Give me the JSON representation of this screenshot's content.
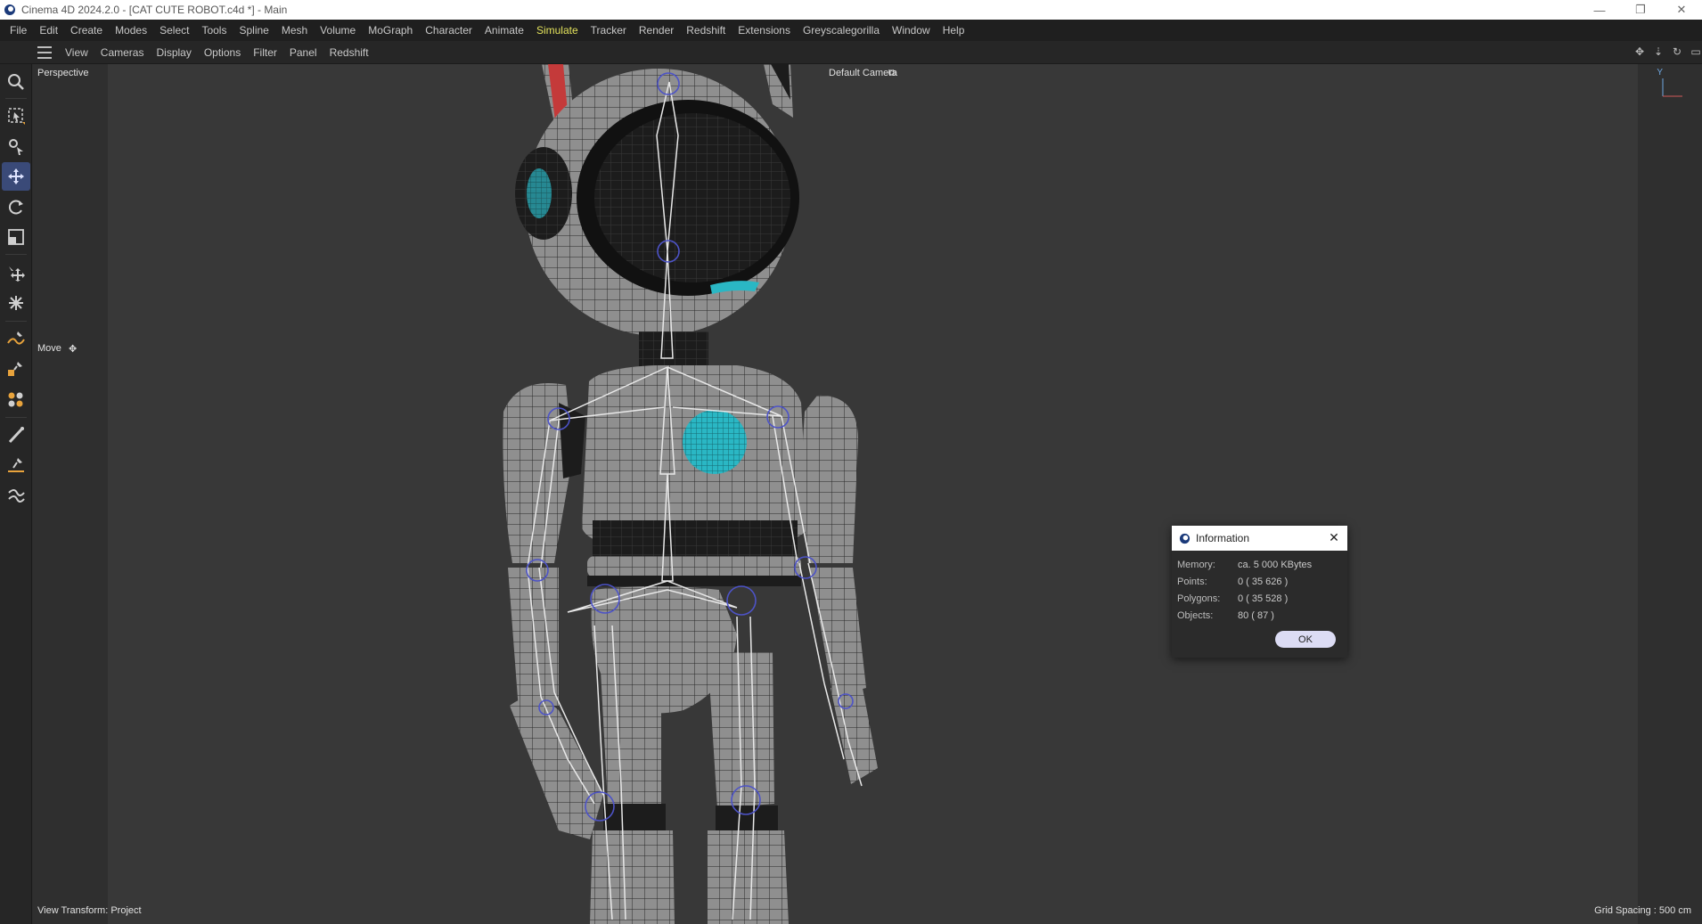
{
  "window": {
    "title": "Cinema 4D 2024.2.0 - [CAT CUTE ROBOT.c4d *] - Main",
    "controls": [
      "—",
      "❐",
      "✕"
    ]
  },
  "menubar": {
    "items": [
      "File",
      "Edit",
      "Create",
      "Modes",
      "Select",
      "Tools",
      "Spline",
      "Mesh",
      "Volume",
      "MoGraph",
      "Character",
      "Animate",
      "Simulate",
      "Tracker",
      "Render",
      "Redshift",
      "Extensions",
      "Greyscalegorilla",
      "Window",
      "Help"
    ],
    "active": "Simulate",
    "active_color": "#e3e25c"
  },
  "viewport_menu": {
    "items": [
      "View",
      "Cameras",
      "Display",
      "Options",
      "Filter",
      "Panel",
      "Redshift"
    ]
  },
  "toolbar": {
    "tools": [
      "search-icon",
      "live-selection-icon",
      "selection-tools-icon",
      "move-icon",
      "rotate-icon",
      "scale-icon",
      "move-along-icon",
      "transform-icon",
      "spline-pen-icon",
      "object-pen-icon",
      "character-icon",
      "brush-icon",
      "sketch-icon",
      "spline-tool-icon"
    ],
    "active": "move-icon"
  },
  "viewport": {
    "view_name": "Perspective",
    "camera": "Default Camera",
    "tool_label": "Move",
    "view_transform": "View Transform: Project",
    "grid_spacing": "Grid Spacing : 500 cm",
    "axis_label": "Y"
  },
  "info_dialog": {
    "title": "Information",
    "rows": [
      {
        "key": "Memory:",
        "value": "ca. 5 000 KBytes"
      },
      {
        "key": "Points:",
        "value": "0 ( 35 626 )"
      },
      {
        "key": "Polygons:",
        "value": "0 ( 35 528 )"
      },
      {
        "key": "Objects:",
        "value": "80 ( 87 )"
      }
    ],
    "ok_label": "OK"
  },
  "colors": {
    "accent_active_tool": "#3a4a78",
    "robot_eye_glow": "#2ab7c4",
    "robot_ear_red": "#c43a3a"
  }
}
